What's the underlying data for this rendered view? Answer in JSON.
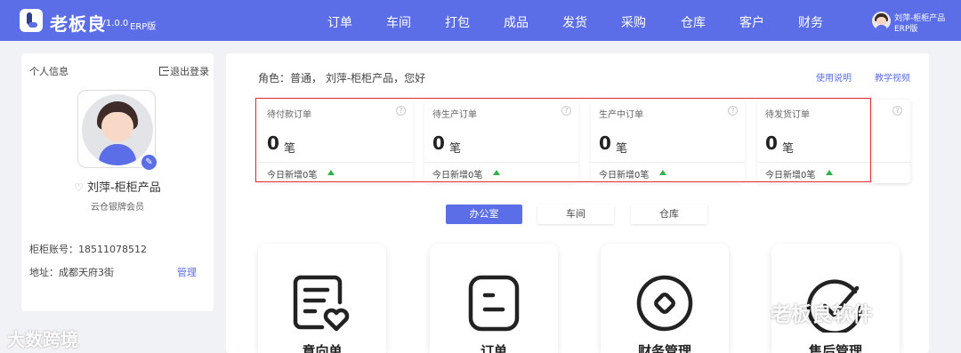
{
  "header": {
    "brand": "老板良",
    "version": "V1.0.0",
    "edition": "ERP版",
    "nav": [
      "订单",
      "车间",
      "打包",
      "成品",
      "发货",
      "采购",
      "仓库",
      "客户",
      "财务"
    ],
    "user_name": "刘萍-柜柜产品",
    "user_edition": "ERP版"
  },
  "profile": {
    "title": "个人信息",
    "logout": "退出登录",
    "name": "刘萍-柜柜产品",
    "member": "云仓银牌会员",
    "account": "柜柜账号：18511078512",
    "address": "地址：成都天府3街",
    "manage": "管理"
  },
  "main": {
    "role": "角色：普通， 刘萍-柜柜产品，您好",
    "manual": "使用说明",
    "video": "教学视频",
    "stats": [
      {
        "title": "待付款订单",
        "value": "0",
        "unit": "笔",
        "footer": "今日新增0笔"
      },
      {
        "title": "待生产订单",
        "value": "0",
        "unit": "笔",
        "footer": "今日新增0笔"
      },
      {
        "title": "生产中订单",
        "value": "0",
        "unit": "笔",
        "footer": "今日新增0笔"
      },
      {
        "title": "待发货订单",
        "value": "0",
        "unit": "笔",
        "footer": "今日新增0笔"
      }
    ],
    "tabs": [
      "办公室",
      "车间",
      "仓库"
    ],
    "modules": [
      "意向单",
      "订单",
      "财务管理",
      "售后管理"
    ]
  },
  "watermarks": {
    "left": "大数跨境",
    "right": "老板良软件"
  },
  "colors": {
    "primary": "#5b6ee8",
    "highlight_box": "#e02b2b",
    "up_arrow": "#2fb24a"
  }
}
